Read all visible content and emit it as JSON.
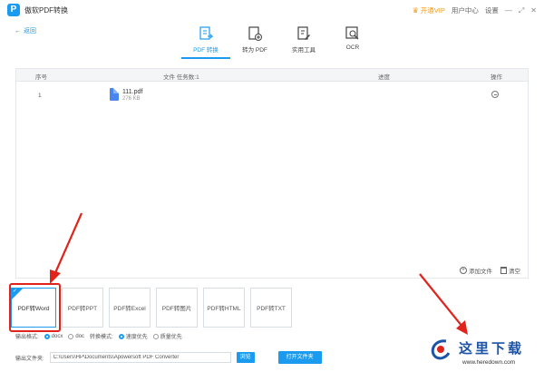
{
  "app": {
    "title": "傲软PDF转换",
    "logo_glyph": "P"
  },
  "titlebar": {
    "vip_label": "开通VIP",
    "user_center": "用户中心",
    "settings": "设置",
    "minimize": "—",
    "maximize": "⤢",
    "close": "✕"
  },
  "nav": {
    "back_label": "返回",
    "back_arrow": "←"
  },
  "tabs": [
    {
      "label": "PDF 转换",
      "icon": "pdf-convert-icon",
      "active": true
    },
    {
      "label": "转为 PDF",
      "icon": "to-pdf-icon",
      "active": false
    },
    {
      "label": "实用工具",
      "icon": "tools-icon",
      "active": false
    },
    {
      "label": "OCR",
      "icon": "ocr-icon",
      "active": false
    }
  ],
  "table": {
    "headers": {
      "index": "序号",
      "file": "文件 任务数:1",
      "progress": "进度",
      "action": "操作"
    },
    "rows": [
      {
        "index": "1",
        "name": "111.pdf",
        "size": "276 KB"
      }
    ]
  },
  "panel_actions": {
    "add_file": "添加文件",
    "clear": "清空"
  },
  "formats": [
    {
      "label": "PDF转Word",
      "selected": true
    },
    {
      "label": "PDF转PPT",
      "selected": false
    },
    {
      "label": "PDF转Excel",
      "selected": false
    },
    {
      "label": "PDF转图片",
      "selected": false
    },
    {
      "label": "PDF转HTML",
      "selected": false
    },
    {
      "label": "PDF转TXT",
      "selected": false
    }
  ],
  "options": {
    "output_format_label": "输出格式:",
    "docx": "docx",
    "doc": "doc",
    "mode_label": "转换模式:",
    "speed": "速度优先",
    "quality": "质量优先"
  },
  "output": {
    "label": "输出文件夹:",
    "path": "C:\\Users\\HP\\Documents\\Apowersoft PDF Converter",
    "browse": "浏览",
    "open_folder": "打开文件夹"
  },
  "watermark": {
    "cn": "这里下载",
    "url": "www.heredown.com"
  },
  "colors": {
    "accent": "#1a9bf0",
    "annotation": "#e0241b",
    "vip": "#f29b1d"
  }
}
